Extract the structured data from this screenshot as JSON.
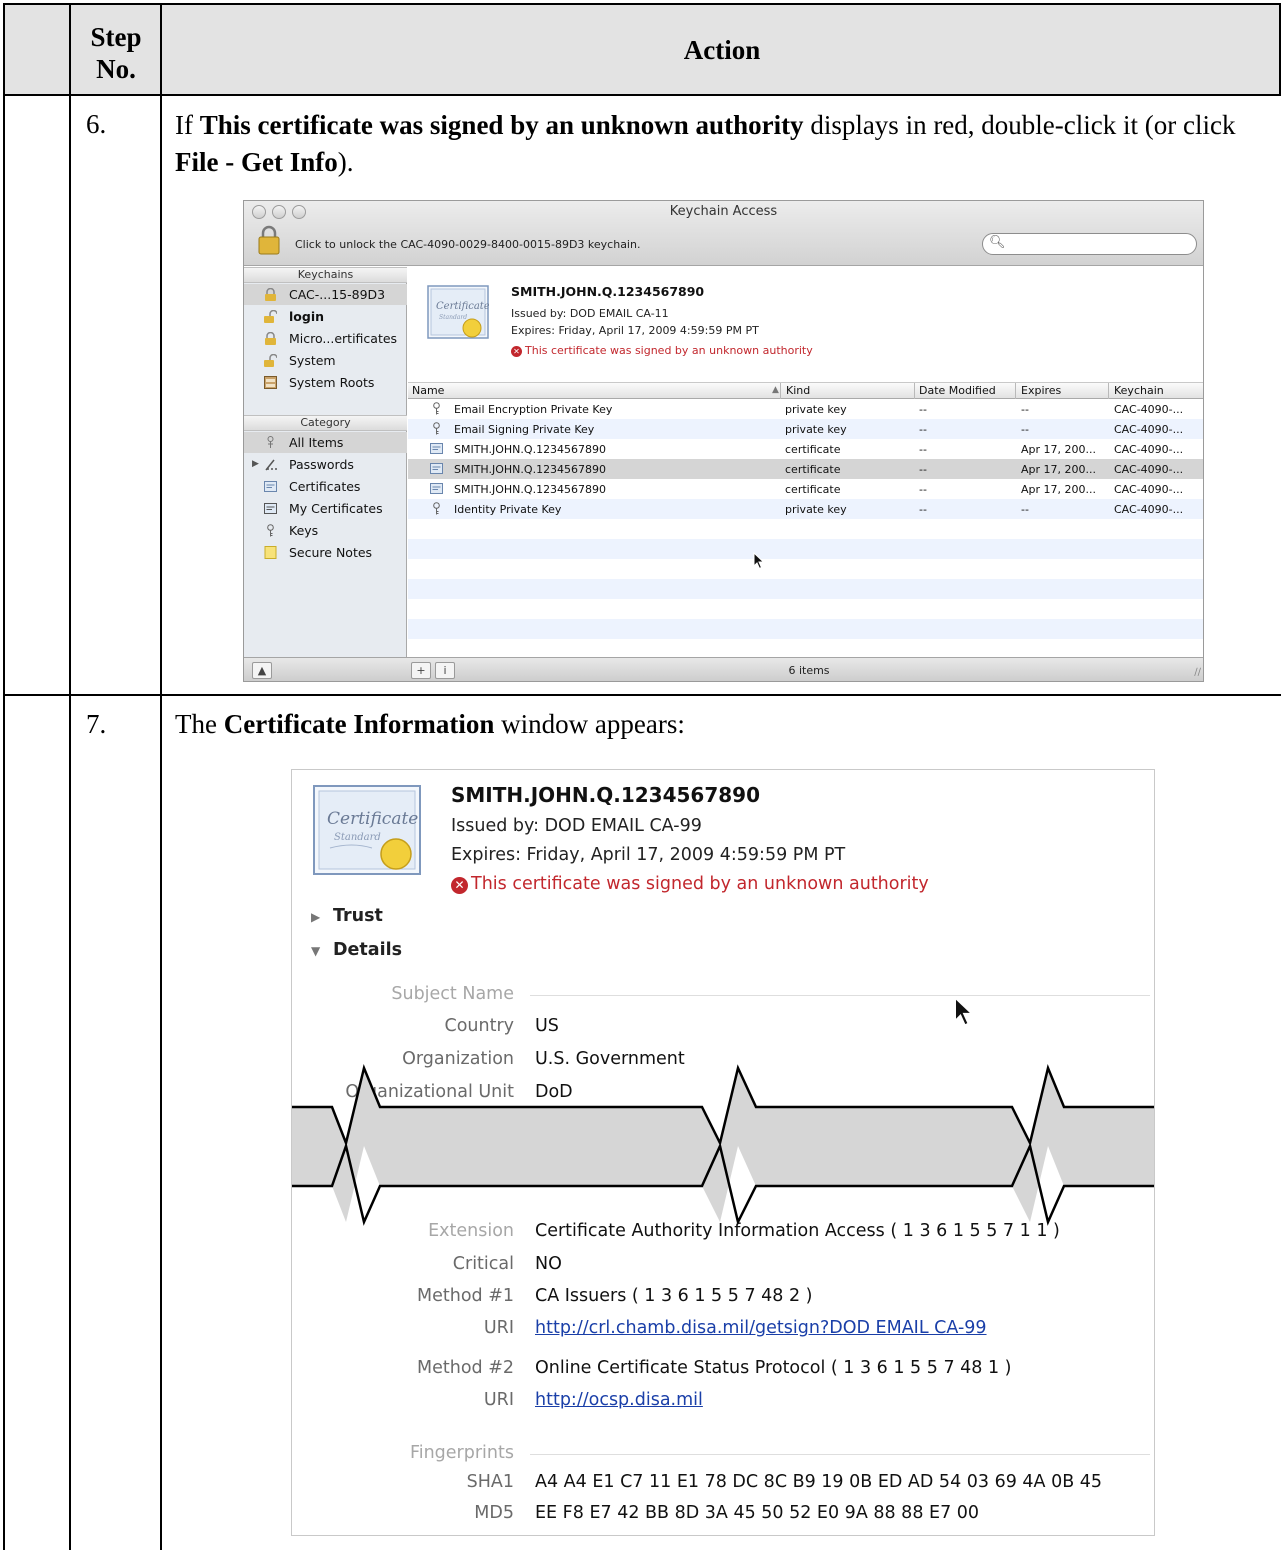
{
  "header": {
    "step_col": "Step No.",
    "action_col": "Action"
  },
  "steps": [
    {
      "number": "6.",
      "text_pre": "If ",
      "text_bold1": "This certificate was signed by an unknown authority",
      "text_mid": " displays in red, double-click it (or click ",
      "text_bold2": "File - Get Info",
      "text_post": ")."
    },
    {
      "number": "7.",
      "text_pre": "The ",
      "text_bold1": "Certificate Information",
      "text_post": " window appears:"
    }
  ],
  "keychain_window": {
    "title": "Keychain Access",
    "lock_message": "Click to unlock the CAC-4090-0029-8400-0015-89D3 keychain.",
    "search_placeholder": "",
    "keychains_header": "Keychains",
    "keychains": [
      {
        "label": "CAC-...15-89D3",
        "icon": "lock-icon",
        "selected": true
      },
      {
        "label": "login",
        "icon": "unlock-icon",
        "bold": true
      },
      {
        "label": "Micro...ertificates",
        "icon": "lock-icon"
      },
      {
        "label": "System",
        "icon": "unlock-icon"
      },
      {
        "label": "System Roots",
        "icon": "cabinet-icon"
      }
    ],
    "category_header": "Category",
    "categories": [
      {
        "label": "All Items",
        "icon": "all-items-icon",
        "selected": true
      },
      {
        "label": "Passwords",
        "icon": "password-icon",
        "expandable": true
      },
      {
        "label": "Certificates",
        "icon": "certificate-icon"
      },
      {
        "label": "My Certificates",
        "icon": "my-certificate-icon"
      },
      {
        "label": "Keys",
        "icon": "key-icon"
      },
      {
        "label": "Secure Notes",
        "icon": "note-icon"
      }
    ],
    "cert_summary": {
      "name": "SMITH.JOHN.Q.1234567890",
      "issued_by": "Issued by: DOD EMAIL CA-11",
      "expires": "Expires: Friday, April 17, 2009 4:59:59 PM PT",
      "warning": "This certificate was signed by an unknown authority",
      "warning_color": "#c2272d"
    },
    "columns": [
      "Name",
      "Kind",
      "Date Modified",
      "Expires",
      "Keychain"
    ],
    "rows": [
      {
        "name": "Email Encryption Private Key",
        "kind": "private key",
        "date_modified": "--",
        "expires": "--",
        "keychain": "CAC-4090-...",
        "icon": "key-icon"
      },
      {
        "name": "Email Signing Private Key",
        "kind": "private key",
        "date_modified": "--",
        "expires": "--",
        "keychain": "CAC-4090-...",
        "icon": "key-icon"
      },
      {
        "name": "SMITH.JOHN.Q.1234567890",
        "kind": "certificate",
        "date_modified": "--",
        "expires": "Apr 17, 200...",
        "keychain": "CAC-4090-...",
        "icon": "certificate-icon"
      },
      {
        "name": "SMITH.JOHN.Q.1234567890",
        "kind": "certificate",
        "date_modified": "--",
        "expires": "Apr 17, 200...",
        "keychain": "CAC-4090-...",
        "icon": "certificate-icon",
        "selected": true
      },
      {
        "name": "SMITH.JOHN.Q.1234567890",
        "kind": "certificate",
        "date_modified": "--",
        "expires": "Apr 17, 200...",
        "keychain": "CAC-4090-...",
        "icon": "certificate-icon"
      },
      {
        "name": "Identity Private Key",
        "kind": "private key",
        "date_modified": "--",
        "expires": "--",
        "keychain": "CAC-4090-...",
        "icon": "key-icon"
      }
    ],
    "item_count": "6 items",
    "bottom_buttons": {
      "add": "+",
      "info": "i"
    }
  },
  "cert_info_window": {
    "name": "SMITH.JOHN.Q.1234567890",
    "issued_by": "Issued by: DOD EMAIL CA-99",
    "expires": "Expires: Friday, April 17, 2009 4:59:59 PM PT",
    "warning": "This certificate was signed by an unknown authority",
    "trust_label": "Trust",
    "details_label": "Details",
    "subject_section": "Subject Name",
    "subject_fields": [
      {
        "label": "Country",
        "value": "US"
      },
      {
        "label": "Organization",
        "value": "U.S. Government"
      },
      {
        "label": "Organizational Unit",
        "value": "DoD"
      }
    ],
    "extension_fields": [
      {
        "label": "Extension",
        "value": "Certificate Authority Information Access ( 1 3 6 1 5 5 7 1 1 )",
        "section": true
      },
      {
        "label": "Critical",
        "value": "NO"
      },
      {
        "label": "Method #1",
        "value": "CA Issuers ( 1 3 6 1 5 5 7 48 2 )"
      },
      {
        "label": "URI",
        "value": "http://crl.chamb.disa.mil/getsign?DOD EMAIL CA-99",
        "link": true
      },
      {
        "label": "Method #2",
        "value": "Online Certificate Status Protocol ( 1 3 6 1 5 5 7 48 1 )"
      },
      {
        "label": "URI",
        "value": "http://ocsp.disa.mil",
        "link": true
      }
    ],
    "fingerprints_section": "Fingerprints",
    "fingerprints": [
      {
        "label": "SHA1",
        "value": "A4 A4 E1 C7 11 E1 78 DC 8C B9 19 0B ED AD 54 03 69 4A 0B 45"
      },
      {
        "label": "MD5",
        "value": "EE F8 E7 42 BB 8D 3A 45 50 52 E0 9A 88 88 E7 00"
      }
    ]
  }
}
